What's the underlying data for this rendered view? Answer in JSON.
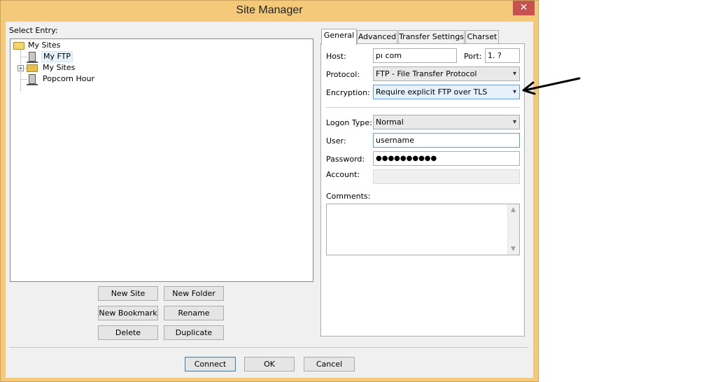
{
  "window": {
    "title": "Site Manager",
    "close": "✕"
  },
  "left": {
    "select_entry_label": "Select Entry:",
    "tree": {
      "root": "My Sites",
      "children": [
        "My FTP",
        "My Sites",
        "Popcorn Hour"
      ]
    },
    "buttons": {
      "new_site": "New Site",
      "new_folder": "New Folder",
      "new_bookmark": "New Bookmark",
      "rename": "Rename",
      "delete": "Delete",
      "duplicate": "Duplicate"
    }
  },
  "tabs": [
    "General",
    "Advanced",
    "Transfer Settings",
    "Charset"
  ],
  "general": {
    "host_label": "Host:",
    "host_value": "pı                  com",
    "port_label": "Port:",
    "port_value": "1.   ?",
    "protocol_label": "Protocol:",
    "protocol_value": "FTP - File Transfer Protocol",
    "encryption_label": "Encryption:",
    "encryption_value": "Require explicit FTP over TLS",
    "logon_label": "Logon Type:",
    "logon_value": "Normal",
    "user_label": "User:",
    "user_value": "username",
    "password_label": "Password:",
    "password_value": "●●●●●●●●●●",
    "account_label": "Account:",
    "comments_label": "Comments:"
  },
  "footer": {
    "connect": "Connect",
    "ok": "OK",
    "cancel": "Cancel"
  },
  "colors": {
    "titlebar": "#f4ca7a",
    "close": "#c75050",
    "focus": "#569de5"
  }
}
